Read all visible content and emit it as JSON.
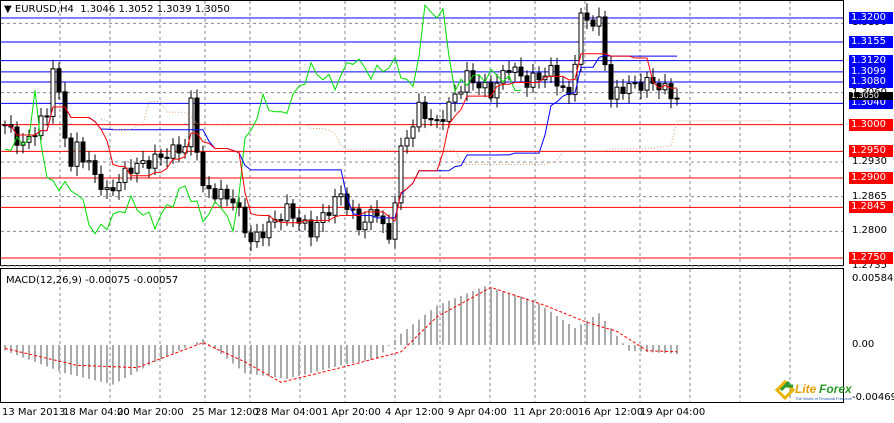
{
  "header": {
    "symbol": "EURUSD,H4",
    "open": "1.3046",
    "high": "1.3052",
    "low": "1.3039",
    "close": "1.3050"
  },
  "price_levels": [
    {
      "value": "1.3200",
      "color": "#0000ff"
    },
    {
      "value": "1.3155",
      "color": "#0000ff"
    },
    {
      "value": "1.3120",
      "color": "#0000ff"
    },
    {
      "value": "1.3099",
      "color": "#0000ff"
    },
    {
      "value": "1.3080",
      "color": "#0000ff"
    },
    {
      "value": "1.3040",
      "color": "#0000ff"
    },
    {
      "value": "1.3000",
      "color": "#ff0000"
    },
    {
      "value": "1.2950",
      "color": "#ff0000"
    },
    {
      "value": "1.2900",
      "color": "#ff0000"
    },
    {
      "value": "1.2845",
      "color": "#ff0000"
    },
    {
      "value": "1.2750",
      "color": "#ff0000"
    }
  ],
  "current_price": "1.3050",
  "price_ticks": [
    "1.3190",
    "1.3060",
    "1.2930",
    "1.2865",
    "1.2800",
    "1.2735"
  ],
  "macd": {
    "label": "MACD(12,26,9) -0.00075 -0.00057",
    "ticks": [
      "0.00584",
      "0.00",
      "-0.00469"
    ]
  },
  "time_labels": [
    "13 Mar 2013",
    "18 Mar 04:00",
    "20 Mar 20:00",
    "25 Mar 12:00",
    "28 Mar 04:00",
    "1 Apr 20:00",
    "4 Apr 12:00",
    "9 Apr 04:00",
    "11 Apr 20:00",
    "16 Apr 12:00",
    "19 Apr 04:00"
  ],
  "logo": {
    "text": "LiteForex",
    "tagline": "The World of Financial Freedom"
  },
  "chart_data": {
    "type": "line",
    "price_keypoints": [
      [
        0,
        1.3
      ],
      [
        3,
        1.296
      ],
      [
        7,
        1.302
      ],
      [
        8,
        1.311
      ],
      [
        9,
        1.305
      ],
      [
        11,
        1.292
      ],
      [
        12,
        1.296
      ],
      [
        17,
        1.287
      ],
      [
        21,
        1.292
      ],
      [
        24,
        1.293
      ],
      [
        30,
        1.296
      ],
      [
        31,
        1.304
      ],
      [
        33,
        1.288
      ],
      [
        38,
        1.286
      ],
      [
        41,
        1.278
      ],
      [
        47,
        1.284
      ],
      [
        51,
        1.28
      ],
      [
        56,
        1.287
      ],
      [
        59,
        1.281
      ],
      [
        62,
        1.284
      ],
      [
        64,
        1.278
      ],
      [
        66,
        1.295
      ],
      [
        69,
        1.303
      ],
      [
        72,
        1.3
      ],
      [
        77,
        1.309
      ],
      [
        81,
        1.306
      ],
      [
        84,
        1.311
      ],
      [
        87,
        1.308
      ],
      [
        91,
        1.31
      ],
      [
        94,
        1.305
      ],
      [
        96,
        1.32
      ],
      [
        99,
        1.319
      ],
      [
        101,
        1.305
      ],
      [
        103,
        1.307
      ],
      [
        108,
        1.308
      ],
      [
        112,
        1.305
      ]
    ],
    "macd_keypoints": [
      [
        0,
        -0.0005
      ],
      [
        10,
        -0.0025
      ],
      [
        18,
        -0.0035
      ],
      [
        25,
        -0.0015
      ],
      [
        33,
        0.0005
      ],
      [
        40,
        -0.0025
      ],
      [
        47,
        -0.003
      ],
      [
        56,
        -0.0018
      ],
      [
        62,
        -0.0012
      ],
      [
        66,
        0.001
      ],
      [
        72,
        0.0035
      ],
      [
        80,
        0.0052
      ],
      [
        88,
        0.004
      ],
      [
        95,
        0.0015
      ],
      [
        99,
        0.0028
      ],
      [
        104,
        -0.0005
      ],
      [
        112,
        -0.0008
      ]
    ],
    "signal_keypoints": [
      [
        0,
        -0.0003
      ],
      [
        12,
        -0.0018
      ],
      [
        22,
        -0.002
      ],
      [
        33,
        0.0002
      ],
      [
        40,
        -0.0015
      ],
      [
        46,
        -0.0033
      ],
      [
        56,
        -0.002
      ],
      [
        66,
        -0.0006
      ],
      [
        72,
        0.0025
      ],
      [
        81,
        0.0051
      ],
      [
        90,
        0.0035
      ],
      [
        97,
        0.002
      ],
      [
        102,
        0.0012
      ],
      [
        107,
        -0.0005
      ],
      [
        112,
        -0.0006
      ]
    ],
    "ylim": [
      1.2735,
      1.3215
    ],
    "macd_ylim": [
      -0.00469,
      0.00584
    ]
  }
}
